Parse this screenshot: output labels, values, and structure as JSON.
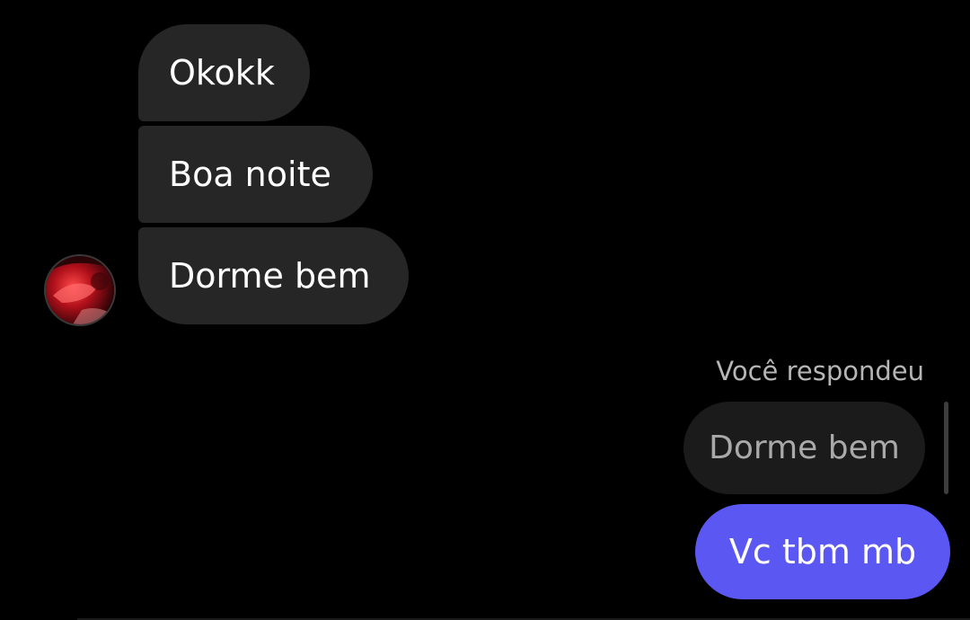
{
  "thread": {
    "received_messages": [
      {
        "text": "Okokk"
      },
      {
        "text": "Boa noite"
      },
      {
        "text": "Dorme bem"
      }
    ],
    "reply": {
      "label": "Você respondeu",
      "quoted_text": "Dorme bem",
      "sent_text": "Vc tbm mb"
    }
  },
  "colors": {
    "background": "#000000",
    "received_bubble": "#262626",
    "quoted_bubble": "#1b1b1b",
    "sent_bubble": "#5b57f3",
    "text": "#ffffff",
    "muted_text": "#b6b6b6"
  }
}
